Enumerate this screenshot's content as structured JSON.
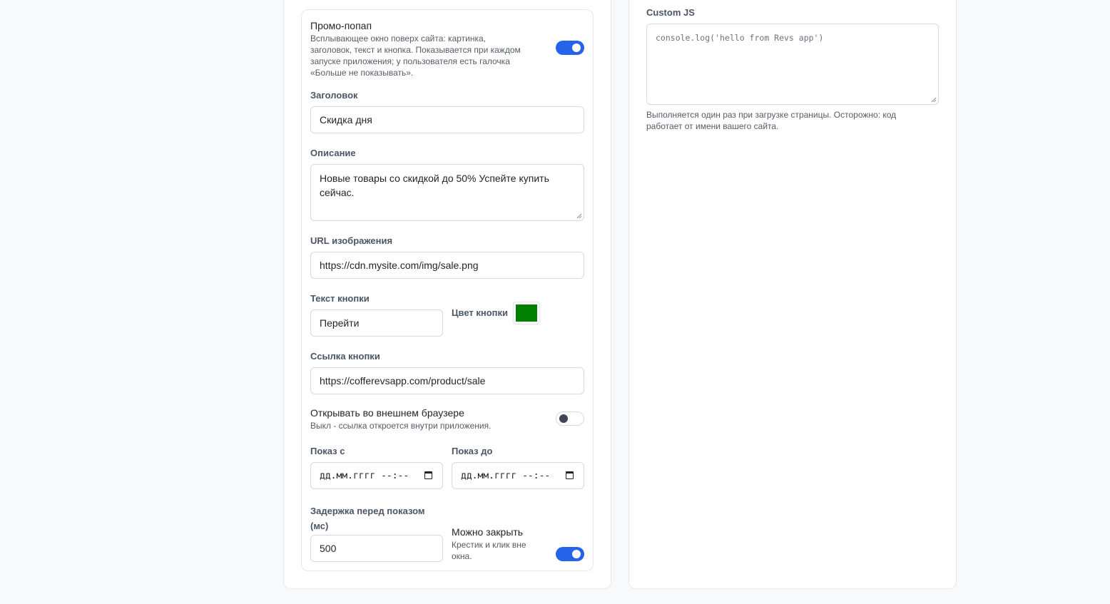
{
  "promo": {
    "title": "Промо-попап",
    "description_lines": [
      "Всплывающее окно поверх сайта: картинка,",
      "заголовок, текст и кнопка. Показывается при каждом",
      "запуске приложения; у пользователя есть галочка",
      "«Больше не показывать»."
    ],
    "enabled": true
  },
  "fields": {
    "heading_label": "Заголовок",
    "heading_value": "Скидка дня",
    "description_label": "Описание",
    "description_line1": "Новые товары со скидкой до 50% Успейте купить",
    "description_line2": "сейчас.",
    "image_url_label": "URL изображения",
    "image_url_value": "https://cdn.mysite.com/img/sale.png",
    "button_text_label": "Текст кнопки",
    "button_text_value": "Перейти",
    "button_color_label": "Цвет кнопки",
    "button_color_value": "#008000",
    "button_link_label": "Ссылка кнопки",
    "button_link_value": "https://cofferevsapp.com/product/sale"
  },
  "external_browser": {
    "title": "Открывать во внешнем браузере",
    "help": "Выкл - ссылка откроется внутри приложения.",
    "enabled": false
  },
  "schedule": {
    "from_label": "Показ с",
    "from_placeholder": "дд.мм.гггг --:--",
    "to_label": "Показ до",
    "to_placeholder": "дд.мм.гггг --:--"
  },
  "delay": {
    "label_line1": "Задержка перед показом",
    "label_line2": "(мс)",
    "value": "500"
  },
  "closable": {
    "title": "Можно закрыть",
    "help_line1": "Крестик и клик вне",
    "help_line2": "окна.",
    "enabled": true
  },
  "custom_js": {
    "label": "Custom JS",
    "placeholder": "console.log('hello from Revs app')",
    "help_line1": "Выполняется один раз при загрузке страницы. Осторожно: код",
    "help_line2": "работает от имени вашего сайта."
  },
  "colors": {
    "accent": "#2563eb",
    "button_color": "#008000"
  }
}
